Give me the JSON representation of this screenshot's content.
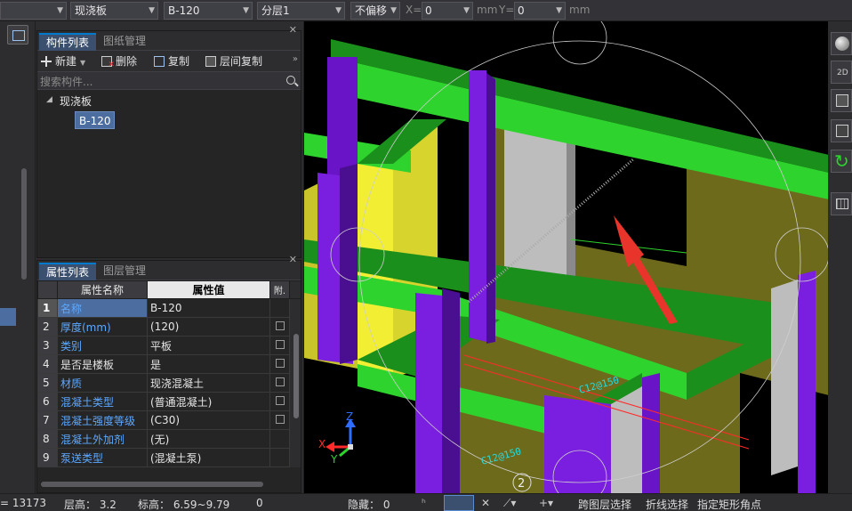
{
  "toolbar": {
    "type_select": "现浇板",
    "name_select": "B-120",
    "layer_select": "分层1",
    "offset_select": "不偏移",
    "x_label": "X=",
    "x_value": "0",
    "x_unit": "mm",
    "y_label": "Y=",
    "y_value": "0",
    "y_unit": "mm"
  },
  "component_panel": {
    "tabs": [
      {
        "label": "构件列表",
        "active": true
      },
      {
        "label": "图纸管理",
        "active": false
      }
    ],
    "actions": {
      "new": "新建",
      "delete": "删除",
      "copy": "复制",
      "floor_copy": "层间复制"
    },
    "search_placeholder": "搜索构件...",
    "tree": {
      "parent": "现浇板",
      "child": "B-120"
    }
  },
  "property_panel": {
    "tabs": [
      {
        "label": "属性列表",
        "active": true
      },
      {
        "label": "图层管理",
        "active": false
      }
    ],
    "headers": {
      "name": "属性名称",
      "value": "属性值",
      "extra": "附."
    },
    "rows": [
      {
        "num": "1",
        "name": "名称",
        "value": "B-120",
        "blue": true,
        "checkbox": false
      },
      {
        "num": "2",
        "name": "厚度(mm)",
        "value": "(120)",
        "blue": true,
        "checkbox": true
      },
      {
        "num": "3",
        "name": "类别",
        "value": "平板",
        "blue": true,
        "checkbox": true
      },
      {
        "num": "4",
        "name": "是否是楼板",
        "value": "是",
        "blue": false,
        "checkbox": true
      },
      {
        "num": "5",
        "name": "材质",
        "value": "现浇混凝土",
        "blue": true,
        "checkbox": true
      },
      {
        "num": "6",
        "name": "混凝土类型",
        "value": "(普通混凝土)",
        "blue": true,
        "checkbox": true
      },
      {
        "num": "7",
        "name": "混凝土强度等级",
        "value": "(C30)",
        "blue": true,
        "checkbox": true
      },
      {
        "num": "8",
        "name": "混凝土外加剂",
        "value": "(无)",
        "blue": true,
        "checkbox": false
      },
      {
        "num": "9",
        "name": "泵送类型",
        "value": "(混凝土泵)",
        "blue": true,
        "checkbox": false
      }
    ]
  },
  "viewport": {
    "axis_labels": {
      "x": "X",
      "y": "Y",
      "z": "Z"
    },
    "grid_bubble": "2",
    "rebar_text": "C12@150"
  },
  "right_toolbar": {
    "view_2d_label": "2D"
  },
  "statusbar": {
    "coord": "= 13173",
    "floor_height": "层高：  3.2",
    "elevation": "标高：  6.59~9.79",
    "zero": "0",
    "hidden": "隐藏：  0",
    "layer_select": "跨图层选择",
    "polyline_select": "折线选择",
    "rect_corner": "指定矩形角点"
  },
  "colors": {
    "beam_green": "#2ed32e",
    "column_purple": "#7a1fe0",
    "wall_olive": "#6e6a1c",
    "wall_yellow": "#f2ee34",
    "accent_blue": "#4b6da0",
    "arrow_red": "#e8342a"
  }
}
